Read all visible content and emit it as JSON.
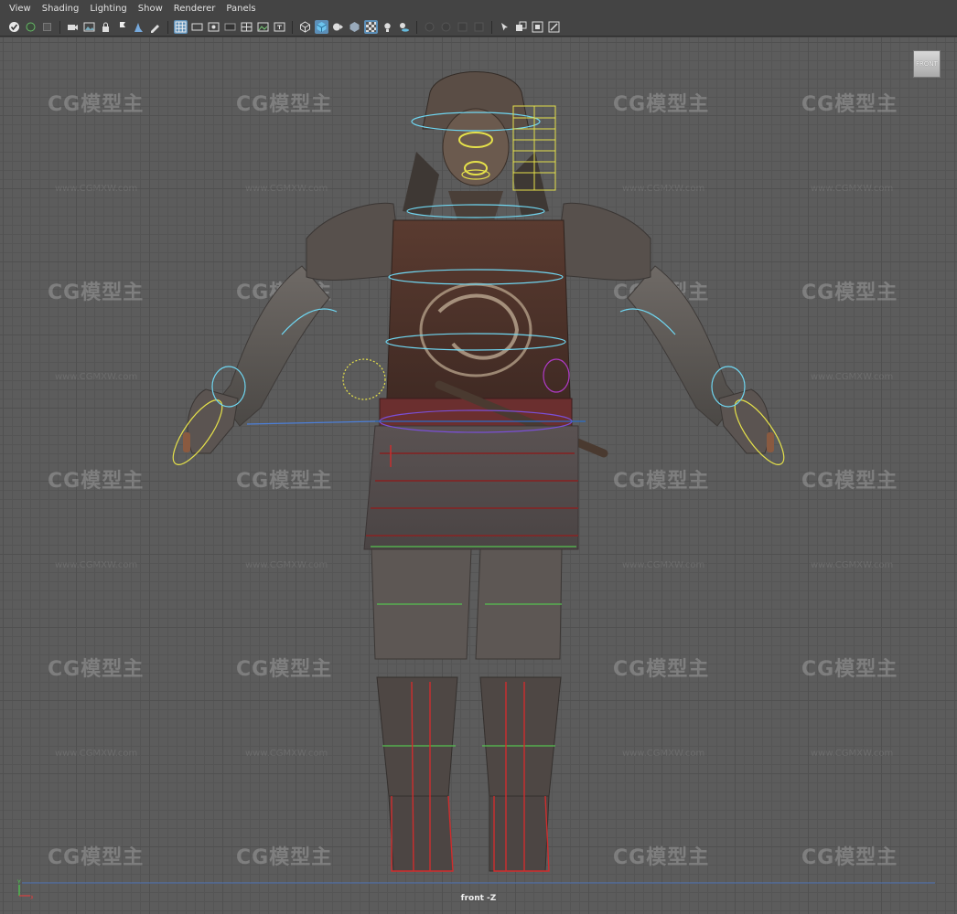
{
  "menus": [
    "View",
    "Shading",
    "Lighting",
    "Show",
    "Renderer",
    "Panels"
  ],
  "toolbar": {
    "icons": [
      "select-camera-icon",
      "camera-attributes-icon",
      "bookmark-icon",
      "movie-camera-icon",
      "image-plane-icon",
      "lock-camera-icon",
      "camera-gate-icon",
      "dolly-icon",
      "pen-icon",
      "grid-icon",
      "film-gate-icon",
      "resolution-gate-icon",
      "gate-mask-icon",
      "field-chart-icon",
      "safe-action-icon",
      "safe-title-icon",
      "wireframe-icon",
      "smooth-shade-icon",
      "wire-on-shaded-icon",
      "default-material-icon",
      "xray-icon",
      "lights-icon",
      "shadows-icon",
      "ao-icon",
      "motion-blur-icon",
      "anti-alias-icon",
      "depth-of-field-icon",
      "isolate-select-icon",
      "xray-joints-icon",
      "xray-active-icon",
      "backface-culling-icon"
    ],
    "active": [
      "grid-icon",
      "smooth-shade-icon",
      "xray-icon"
    ]
  },
  "watermark": {
    "text": "CG模型主",
    "url": "www.CGMXW.com"
  },
  "viewcube": {
    "label": "FRONT"
  },
  "camera_label": "front -Z",
  "axis": {
    "y": "Y",
    "x": "X"
  }
}
